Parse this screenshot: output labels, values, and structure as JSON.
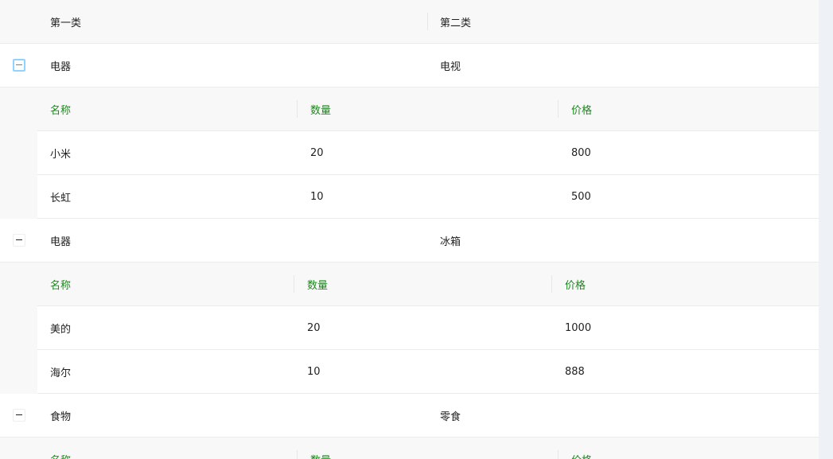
{
  "header": {
    "col1": "第一类",
    "col2": "第二类"
  },
  "nested_header": {
    "name": "名称",
    "qty": "数量",
    "price": "价格"
  },
  "groups": [
    {
      "cat1": "电器",
      "cat2": "电视",
      "expanded_icon": "minus-square-icon",
      "items": [
        {
          "name": "小米",
          "qty": "20",
          "price": "800"
        },
        {
          "name": "长虹",
          "qty": "10",
          "price": "500"
        }
      ]
    },
    {
      "cat1": "电器",
      "cat2": "冰箱",
      "expanded_icon": "minus-square-icon",
      "items": [
        {
          "name": "美的",
          "qty": "20",
          "price": "1000"
        },
        {
          "name": "海尔",
          "qty": "10",
          "price": "888"
        }
      ]
    },
    {
      "cat1": "食物",
      "cat2": "零食",
      "expanded_icon": "minus-square-icon",
      "items": []
    }
  ],
  "colors": {
    "nested_header_text": "#1a8a1a",
    "expand_active": "#1aa0e8"
  }
}
